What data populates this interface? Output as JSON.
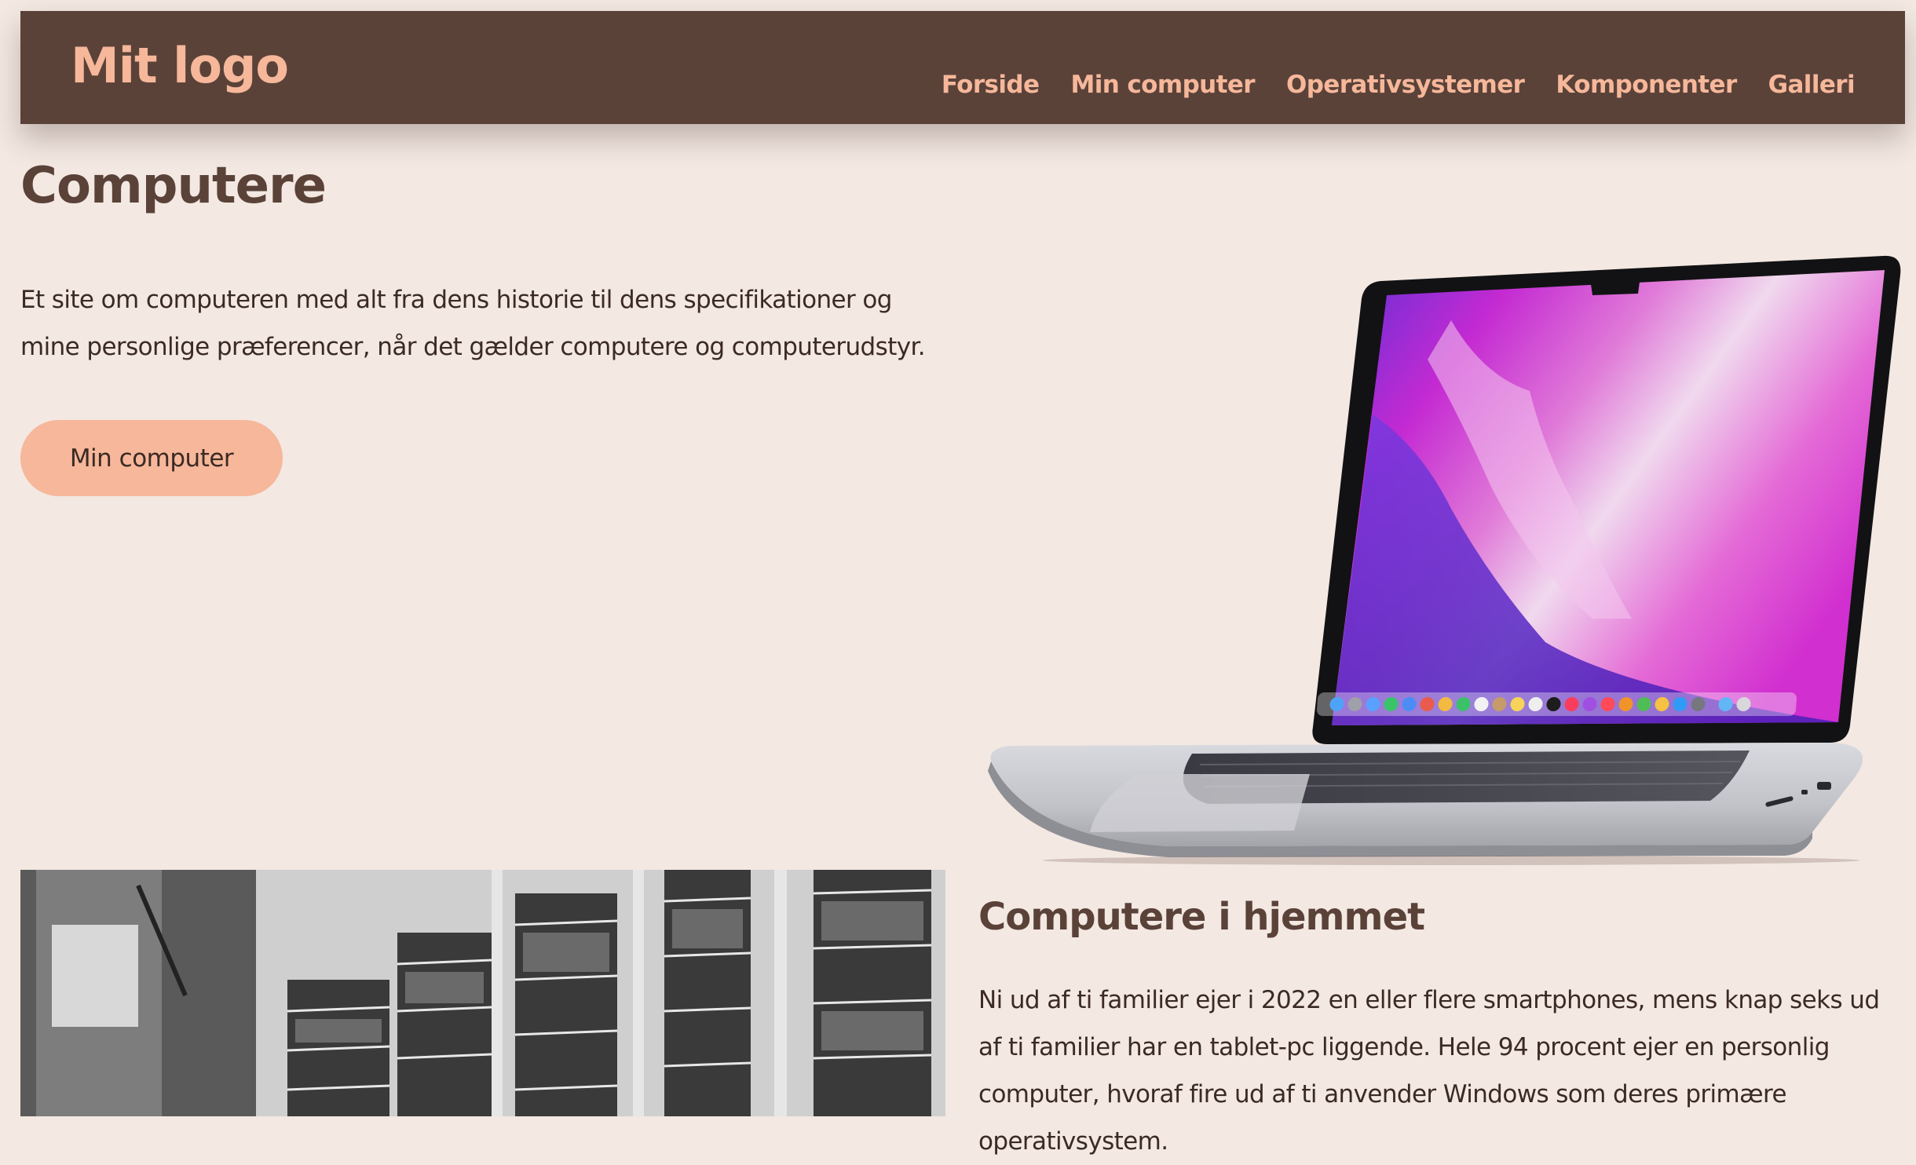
{
  "header": {
    "logo": "Mit logo",
    "nav": [
      {
        "label": "Forside"
      },
      {
        "label": "Min computer"
      },
      {
        "label": "Operativsystemer"
      },
      {
        "label": "Komponenter"
      },
      {
        "label": "Galleri"
      }
    ]
  },
  "hero": {
    "title": "Computere",
    "text": "Et site om computeren med alt fra dens historie til dens specifikationer og mine personlige præferencer, når det gælder computere og computerudstyr.",
    "button_label": "Min computer"
  },
  "section": {
    "title": "Computere i hjemmet",
    "text": "Ni ud af ti familier ejer i 2022 en eller flere smartphones, mens knap seks ud af ti familier har en tablet-pc liggende. Hele 94 procent ejer en personlig computer, hvoraf fire ud af ti anvender Windows som deres primære operativsystem."
  },
  "colors": {
    "page_bg": "#f3e8e2",
    "nav_bg": "#5a4239",
    "accent": "#f6b79a",
    "heading": "#5a4239",
    "text": "#3b2a24"
  }
}
